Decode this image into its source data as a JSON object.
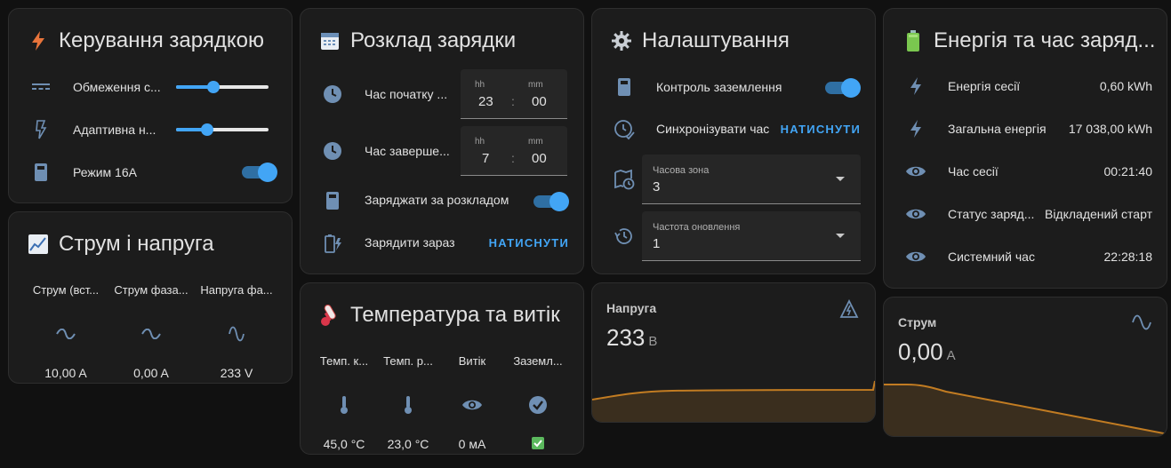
{
  "charge_control": {
    "title": "Керування зарядкою",
    "rows": [
      {
        "label": "Обмеження с...",
        "slider_value": 0.4
      },
      {
        "label": "Адаптивна н...",
        "slider_value": 0.34
      },
      {
        "label": "Режим 16А",
        "toggle_on": true
      }
    ]
  },
  "current_voltage": {
    "title": "Струм і напруга",
    "columns": [
      {
        "header": "Струм (вст...",
        "value": "10,00 A"
      },
      {
        "header": "Струм фаза...",
        "value": "0,00 A"
      },
      {
        "header": "Напруга фа...",
        "value": "233 V"
      }
    ]
  },
  "schedule": {
    "title": "Розклад зарядки",
    "start": {
      "label": "Час початку ...",
      "hh_label": "hh",
      "mm_label": "mm",
      "hh": "23",
      "mm": "00",
      "sep": ":"
    },
    "end": {
      "label": "Час заверше...",
      "hh_label": "hh",
      "mm_label": "mm",
      "hh": "7",
      "mm": "00",
      "sep": ":"
    },
    "scheduled": {
      "label": "Заряджати за розкладом",
      "toggle_on": true
    },
    "charge_now": {
      "label": "Зарядити зараз",
      "button": "НАТИСНУТИ"
    }
  },
  "temperature": {
    "title": "Температура та витік",
    "columns": [
      {
        "header": "Темп. к...",
        "value": "45,0 °C",
        "icon": "thermometer-icon"
      },
      {
        "header": "Темп. р...",
        "value": "23,0 °C",
        "icon": "thermometer-icon"
      },
      {
        "header": "Витік",
        "value": "0 мА",
        "icon": "eye-icon"
      },
      {
        "header": "Заземл...",
        "value": "",
        "icon": "check-circle-icon"
      }
    ]
  },
  "settings": {
    "title": "Налаштування",
    "ground": {
      "label": "Контроль заземлення",
      "toggle_on": true
    },
    "sync": {
      "label": "Синхронізувати час",
      "button": "НАТИСНУТИ"
    },
    "timezone": {
      "caption": "Часова зона",
      "value": "3"
    },
    "refresh": {
      "caption": "Частота оновлення",
      "value": "1"
    }
  },
  "voltage_sensor": {
    "name": "Напруга",
    "value": "233",
    "unit": "В"
  },
  "energy": {
    "title": "Енергія та час заряд...",
    "rows": [
      {
        "label": "Енергія сесії",
        "value": "0,60 kWh",
        "icon": "flash-icon"
      },
      {
        "label": "Загальна енергія",
        "value": "17 038,00 kWh",
        "icon": "flash-icon"
      },
      {
        "label": "Час сесії",
        "value": "00:21:40",
        "icon": "eye-icon"
      },
      {
        "label": "Статус заряд...",
        "value": "Відкладений старт",
        "icon": "eye-icon"
      },
      {
        "label": "Системний час",
        "value": "22:28:18",
        "icon": "eye-icon"
      }
    ]
  },
  "current_sensor": {
    "name": "Струм",
    "value": "0,00",
    "unit": "A"
  },
  "colors": {
    "accent": "#42a5f5",
    "icon": "#6f8fb3",
    "graph": "#c27c22",
    "card": "#1c1c1c"
  }
}
